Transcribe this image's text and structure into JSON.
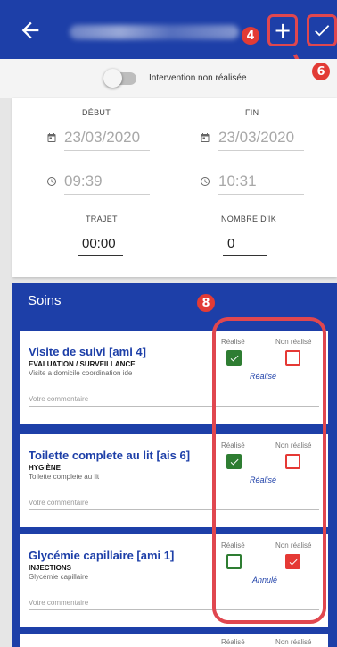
{
  "header": {
    "back_icon": "arrow-left-icon",
    "add_icon": "plus-icon",
    "confirm_icon": "check-icon",
    "badge_add": "4",
    "badge_confirm": "6"
  },
  "intervention": {
    "toggle_label": "Intervention non réalisée"
  },
  "dates": {
    "debut_label": "DÉBUT",
    "fin_label": "FIN",
    "debut_date": "23/03/2020",
    "fin_date": "23/03/2020",
    "debut_time": "09:39",
    "fin_time": "10:31",
    "trajet_label": "TRAJET",
    "trajet_value": "00:00",
    "ik_label": "NOMBRE D'IK",
    "ik_value": "0"
  },
  "soins": {
    "title": "Soins",
    "badge": "8",
    "realise_label": "Réalisé",
    "non_realise_label": "Non réalisé",
    "comment_placeholder": "Votre commentaire",
    "items": [
      {
        "title": "Visite de suivi [ami 4]",
        "category": "EVALUATION / SURVEILLANCE",
        "description": "Visite a domicile coordination ide",
        "status": "Réalisé"
      },
      {
        "title": "Toilette complete au lit [ais 6]",
        "category": "HYGIÈNE",
        "description": "Toilette complete au lit",
        "status": "Réalisé"
      },
      {
        "title": "Glycémie capillaire [ami 1]",
        "category": "INJECTIONS",
        "description": "Glycémie capillaire",
        "status": "Annulé"
      }
    ]
  },
  "colors": {
    "primary": "#1d3fa8",
    "success": "#2e7d32",
    "danger": "#e53935",
    "annotation": "#e0474f"
  }
}
